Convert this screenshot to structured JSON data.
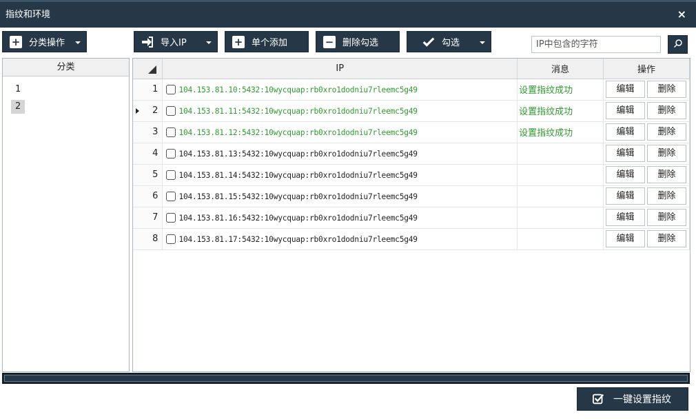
{
  "window": {
    "title": "指纹和环境",
    "close": "×"
  },
  "toolbar": {
    "category_ops": "分类操作",
    "import_ip": "导入IP",
    "add_single": "单个添加",
    "delete_checked": "删除勾选",
    "check": "勾选"
  },
  "search": {
    "placeholder": "IP中包含的字符",
    "value": ""
  },
  "categories": {
    "header": "分类",
    "items": [
      {
        "label": "1",
        "selected": false
      },
      {
        "label": "2",
        "selected": true
      }
    ]
  },
  "grid": {
    "headers": {
      "ip": "IP",
      "message": "消息",
      "actions": "操作"
    },
    "edit_label": "编辑",
    "delete_label": "删除",
    "rows": [
      {
        "num": "1",
        "ip": "104.153.81.10:5432:10wycquap:rb0xro1dodniu7rleemc5g49",
        "message": "设置指纹成功",
        "current": false,
        "success": true
      },
      {
        "num": "2",
        "ip": "104.153.81.11:5432:10wycquap:rb0xro1dodniu7rleemc5g49",
        "message": "设置指纹成功",
        "current": true,
        "success": true
      },
      {
        "num": "3",
        "ip": "104.153.81.12:5432:10wycquap:rb0xro1dodniu7rleemc5g49",
        "message": "设置指纹成功",
        "current": false,
        "success": true
      },
      {
        "num": "4",
        "ip": "104.153.81.13:5432:10wycquap:rb0xro1dodniu7rleemc5g49",
        "message": "",
        "current": false,
        "success": false
      },
      {
        "num": "5",
        "ip": "104.153.81.14:5432:10wycquap:rb0xro1dodniu7rleemc5g49",
        "message": "",
        "current": false,
        "success": false
      },
      {
        "num": "6",
        "ip": "104.153.81.15:5432:10wycquap:rb0xro1dodniu7rleemc5g49",
        "message": "",
        "current": false,
        "success": false
      },
      {
        "num": "7",
        "ip": "104.153.81.16:5432:10wycquap:rb0xro1dodniu7rleemc5g49",
        "message": "",
        "current": false,
        "success": false
      },
      {
        "num": "8",
        "ip": "104.153.81.17:5432:10wycquap:rb0xro1dodniu7rleemc5g49",
        "message": "",
        "current": false,
        "success": false
      }
    ]
  },
  "footer": {
    "set_fingerprint": "一键设置指纹"
  },
  "colors": {
    "primary": "#263847",
    "success_text": "#2f9a2f"
  }
}
